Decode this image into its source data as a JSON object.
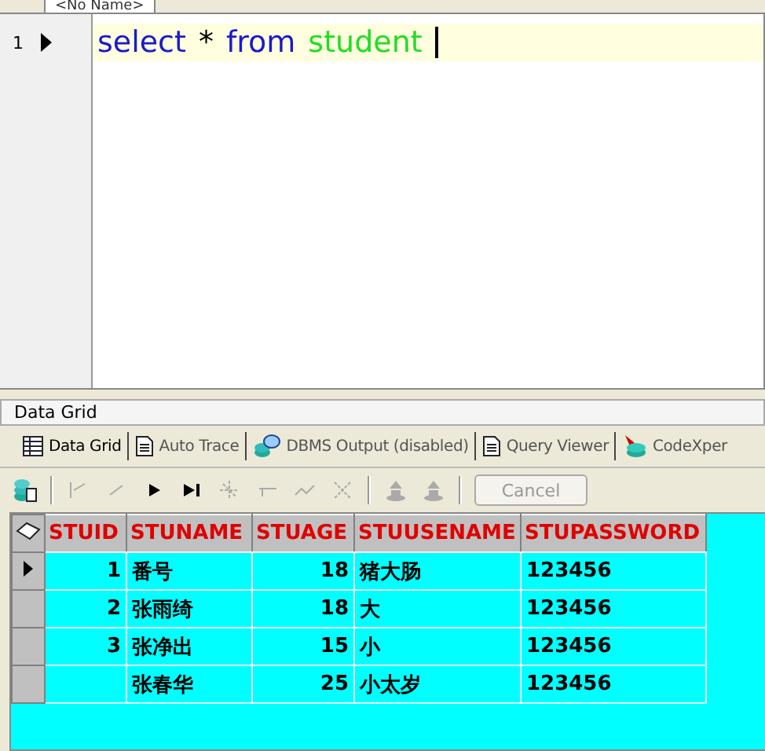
{
  "document_tab": {
    "title": "<No Name>"
  },
  "editor": {
    "lines": [
      {
        "number": "1",
        "current": true,
        "tokens": [
          {
            "text": "select",
            "color": "#1a1acc"
          },
          {
            "text": "*",
            "color": "#000000"
          },
          {
            "text": "from",
            "color": "#1a1acc"
          },
          {
            "text": "student",
            "color": "#22dd22"
          }
        ]
      }
    ]
  },
  "panel_title": "Data Grid",
  "tabs": [
    {
      "label": "Data Grid",
      "kind": "grid",
      "selected": true
    },
    {
      "label": "Auto Trace",
      "kind": "doc",
      "selected": false
    },
    {
      "label": "DBMS Output (disabled)",
      "kind": "db",
      "selected": false
    },
    {
      "label": "Query Viewer",
      "kind": "doc",
      "selected": false
    },
    {
      "label": "CodeXper",
      "kind": "codex",
      "selected": false
    }
  ],
  "toolbar": [
    {
      "kind": "grid-db"
    },
    {
      "kind": "sep"
    },
    {
      "kind": "first",
      "disabled": true
    },
    {
      "kind": "prev",
      "disabled": true
    },
    {
      "kind": "play",
      "disabled": false
    },
    {
      "kind": "last",
      "disabled": false
    },
    {
      "kind": "insert",
      "disabled": true
    },
    {
      "kind": "delete",
      "disabled": true
    },
    {
      "kind": "post",
      "disabled": true
    },
    {
      "kind": "cancel-x",
      "disabled": true
    },
    {
      "kind": "sep"
    },
    {
      "kind": "upload",
      "disabled": true
    },
    {
      "kind": "upload",
      "disabled": true
    },
    {
      "kind": "sep"
    }
  ],
  "cancel_button": {
    "label": "Cancel",
    "disabled": true
  },
  "table": {
    "columns": [
      "STUID",
      "STUNAME",
      "STUAGE",
      "STUUSENAME",
      "STUPASSWORD"
    ],
    "rows": [
      {
        "selected": true,
        "cells": [
          "1",
          "番号",
          "18",
          "猪大肠",
          "123456"
        ]
      },
      {
        "selected": false,
        "cells": [
          "2",
          "张雨绮",
          "18",
          "大",
          "123456"
        ]
      },
      {
        "selected": false,
        "cells": [
          "3",
          "张净出",
          "15",
          "小",
          "123456"
        ]
      },
      {
        "selected": false,
        "cells": [
          "",
          "张春华",
          "25",
          "小太岁",
          "123456"
        ]
      }
    ]
  }
}
